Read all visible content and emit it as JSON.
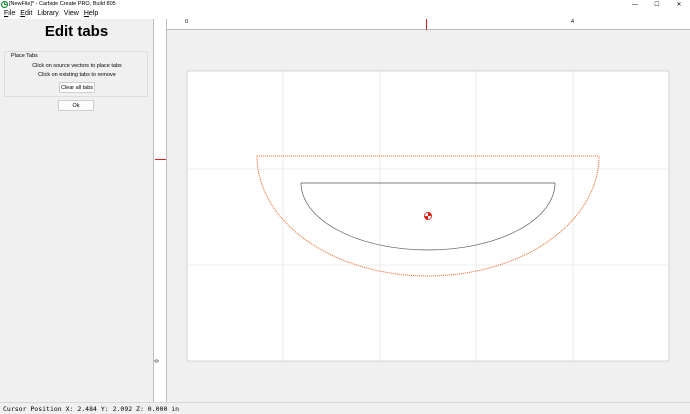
{
  "window": {
    "title": "[NewFile]* - Carbide Create PRO, Build 805",
    "icon": "carbide-create-icon",
    "controls": {
      "minimize": "—",
      "maximize": "☐",
      "close": "✕"
    }
  },
  "menu": {
    "items": [
      {
        "mnemonic": "F",
        "rest": "ile"
      },
      {
        "mnemonic": "E",
        "rest": "dit"
      },
      {
        "mnemonic": "",
        "rest": "Library"
      },
      {
        "mnemonic": "",
        "rest": "View"
      },
      {
        "mnemonic": "H",
        "rest": "elp"
      }
    ]
  },
  "panel": {
    "title": "Edit tabs",
    "group_title": "Place Tabs",
    "hint_place": "Click on source vectors to place tabs",
    "hint_remove": "Click on existing tabs to remove",
    "clear_button": "Clear all tabs",
    "ok_button": "Ok"
  },
  "rulers": {
    "top_labels": [
      "0",
      "4"
    ],
    "left_labels": [
      "0"
    ],
    "marker_color": "#e0201a"
  },
  "canvas": {
    "stock_color": "#ffffff",
    "grid_color": "#dddddd",
    "toolpath_color": "#f07840",
    "vector_color": "#555555",
    "origin_marker": "target-icon"
  },
  "status": {
    "text": "Cursor Position X: 2.484 Y: 2.092 Z: 0.000 in"
  }
}
